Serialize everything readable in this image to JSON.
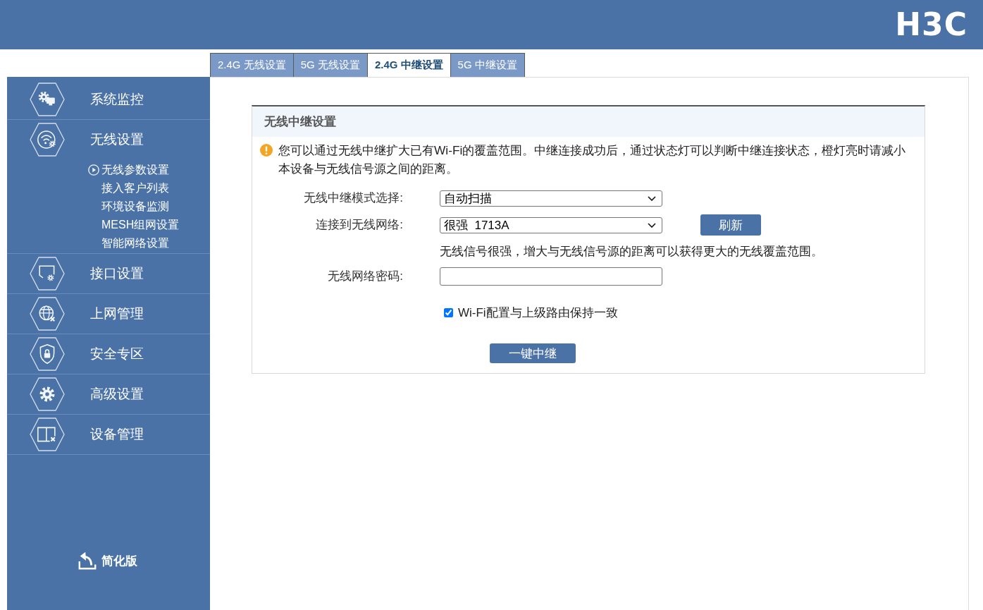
{
  "header": {
    "logo": "H3C"
  },
  "tabs": [
    {
      "label": "2.4G 无线设置",
      "selected": false
    },
    {
      "label": "5G 无线设置",
      "selected": false
    },
    {
      "label": "2.4G 中继设置",
      "selected": true
    },
    {
      "label": "5G 中继设置",
      "selected": false
    }
  ],
  "sidebar": {
    "items": [
      {
        "label": "系统监控"
      },
      {
        "label": "无线设置",
        "children": [
          {
            "label": "无线参数设置",
            "selected": true
          },
          {
            "label": "接入客户列表",
            "selected": false
          },
          {
            "label": "环境设备监测",
            "selected": false
          },
          {
            "label": "MESH组网设置",
            "selected": false
          },
          {
            "label": "智能网络设置",
            "selected": false
          }
        ]
      },
      {
        "label": "接口设置"
      },
      {
        "label": "上网管理"
      },
      {
        "label": "安全专区"
      },
      {
        "label": "高级设置"
      },
      {
        "label": "设备管理"
      }
    ],
    "footer_link": "简化版"
  },
  "panel": {
    "title": "无线中继设置",
    "notice": "您可以通过无线中继扩大已有Wi-Fi的覆盖范围。中继连接成功后，通过状态灯可以判断中继连接状态，橙灯亮时请减小本设备与无线信号源之间的距离。",
    "fields": [
      {
        "kind": "select",
        "label": "无线中继模式选择:",
        "value": "自动扫描"
      },
      {
        "kind": "select",
        "label": "连接到无线网络:",
        "value": "很强  1713A",
        "button": "刷新",
        "hint": "无线信号很强，增大与无线信号源的距离可以获得更大的无线覆盖范围。"
      },
      {
        "kind": "password",
        "label": "无线网络密码:"
      },
      {
        "kind": "checkbox",
        "label": "Wi-Fi配置与上级路由保持一致",
        "checked": true
      }
    ],
    "submit": "一键中继"
  }
}
